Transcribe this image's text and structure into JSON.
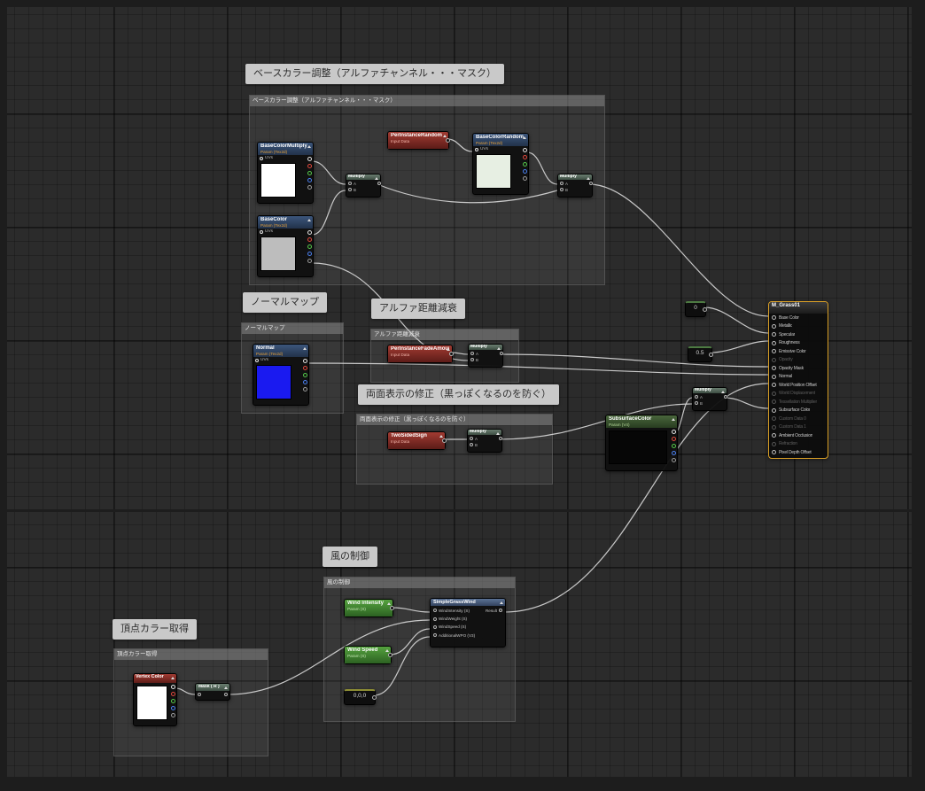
{
  "pins": {
    "uvs": "UVs",
    "a": "A",
    "b": "B"
  },
  "shared": {
    "multiply": "Multiply",
    "param_tex": "Param (Tex2d)",
    "param_scalar": "Param (S)",
    "param_vector": "Param (V4)",
    "input_data": "Input Data"
  },
  "comments": {
    "base": {
      "title": "ベースカラー調整（アルファチャンネル・・・マスク）"
    },
    "normal_map": {
      "title": "ノーマルマップ"
    },
    "alpha_fade": {
      "title": "アルファ距離減衰"
    },
    "two_sided": {
      "title": "両面表示の修正（黒っぽくなるのを防ぐ）"
    },
    "wind": {
      "title": "風の制御"
    },
    "vertex": {
      "title": "頂点カラー取得"
    }
  },
  "nodes": {
    "base_color_multiply": {
      "title": "BaseColorMultiply"
    },
    "per_instance_random": {
      "title": "PerInstanceRandom"
    },
    "base_color_random": {
      "title": "BaseColorRandom"
    },
    "base_color": {
      "title": "BaseColor"
    },
    "normal": {
      "title": "Normal"
    },
    "per_instance_fade": {
      "title": "PerInstanceFadeAmount"
    },
    "two_sided_sign": {
      "title": "TwoSidedSign"
    },
    "subsurface_color": {
      "title": "SubsurfaceColor"
    },
    "simple_grass_wind": {
      "title": "SimpleGrassWind",
      "inputs": [
        "WindIntensity (S)",
        "WindWeight (S)",
        "WindSpeed (S)",
        "AdditionalWPO (V3)"
      ],
      "output": "Result"
    },
    "wind_intensity": {
      "title": "Wind Intensity"
    },
    "wind_speed": {
      "title": "Wind Speed"
    },
    "vertex_color": {
      "title": "Vertex Color"
    },
    "mask_r": {
      "title": "Mask ( R )"
    },
    "const_zero": {
      "value": "0"
    },
    "const_half": {
      "value": "0.5"
    },
    "const_vec3": {
      "value": "0,0,0"
    }
  },
  "material": {
    "title": "M_Grass01",
    "inputs": [
      "Base Color",
      "Metallic",
      "Specular",
      "Roughness",
      "Emissive Color",
      "Opacity",
      "Opacity Mask",
      "Normal",
      "World Position Offset",
      "World Displacement",
      "Tessellation Multiplier",
      "Subsurface Color",
      "Custom Data 0",
      "Custom Data 1",
      "Ambient Occlusion",
      "Refraction",
      "Pixel Depth Offset"
    ]
  },
  "previews": {
    "base_color_multiply": "#ffffff",
    "base_color_random": "#e7efe3",
    "base_color": "#bdbdbd",
    "normal": "#1a1af0",
    "subsurface_color": "#060606",
    "vertex_color": "#ffffff"
  },
  "colors": {
    "wire": "#d6d6d6",
    "header_texture_param": "#33496b",
    "header_red_input": "#8d2f28",
    "header_scalar_param": "#48913a",
    "header_math": "#57675c",
    "header_function": "#4c6186",
    "material_border": "#d99f26",
    "comment_label_bg": "#c9c9c9"
  }
}
